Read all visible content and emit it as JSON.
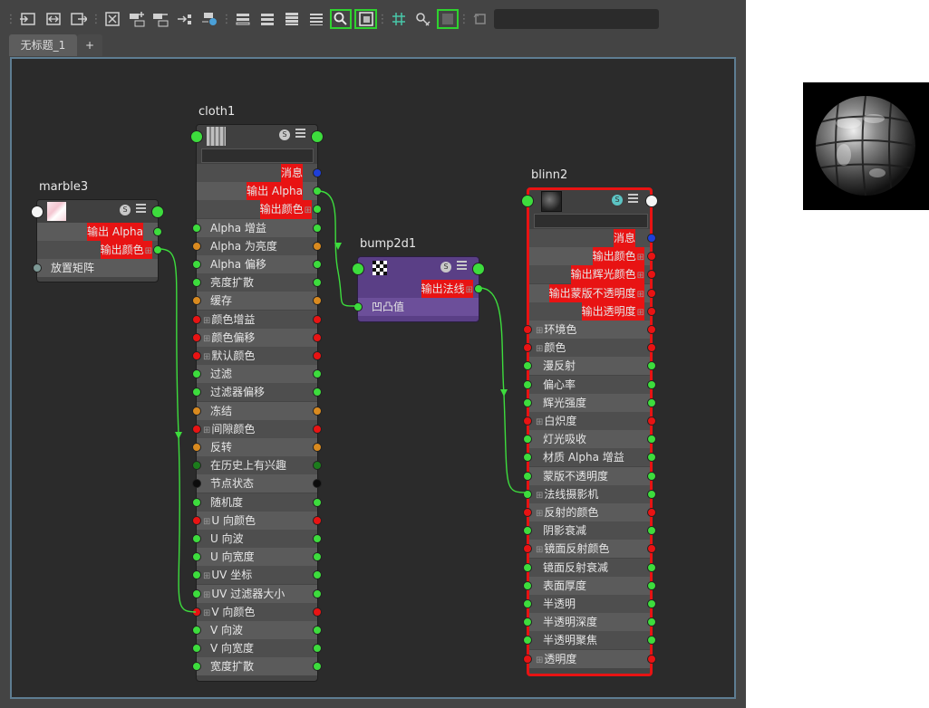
{
  "tabs": {
    "active_label": "无标题_1",
    "add_label": "+"
  },
  "toolbar": {
    "icons": [
      "input-connections-icon",
      "output-connections-icon",
      "in-out-connections-icon",
      "clear-graph-icon",
      "add-selected-icon",
      "remove-selected-icon",
      "rearrange-graph-icon",
      "graph-materials-icon",
      "simple-mode-icon",
      "connected-mode-icon",
      "full-mode-icon",
      "custom-mode-icon",
      "frame-selection-icon",
      "frame-all-icon",
      "grid-toggle-icon",
      "link-toggle-icon",
      "swatch-toggle-icon",
      "refresh-icon"
    ],
    "search_placeholder": ""
  },
  "nodes": {
    "marble3": {
      "title": "marble3",
      "rows": [
        "输出 Alpha",
        "输出颜色",
        "放置矩阵"
      ]
    },
    "cloth1": {
      "title": "cloth1",
      "rows": [
        "消息",
        "输出 Alpha",
        "输出颜色",
        "Alpha 增益",
        "Alpha 为亮度",
        "Alpha 偏移",
        "亮度扩散",
        "缓存",
        "颜色增益",
        "颜色偏移",
        "默认颜色",
        "过滤",
        "过滤器偏移",
        "冻结",
        "间隙颜色",
        "反转",
        "在历史上有兴趣",
        "节点状态",
        "随机度",
        "U 向颜色",
        "U 向波",
        "U 向宽度",
        "UV 坐标",
        "UV 过滤器大小",
        "V 向颜色",
        "V 向波",
        "V 向宽度",
        "宽度扩散"
      ]
    },
    "bump2d1": {
      "title": "bump2d1",
      "rows": [
        "输出法线",
        "凹凸值"
      ]
    },
    "blinn2": {
      "title": "blinn2",
      "rows": [
        "消息",
        "输出颜色",
        "输出辉光颜色",
        "输出蒙版不透明度",
        "输出透明度",
        "环境色",
        "颜色",
        "漫反射",
        "偏心率",
        "辉光强度",
        "白炽度",
        "灯光吸收",
        "材质 Alpha 增益",
        "蒙版不透明度",
        "法线摄影机",
        "反射的颜色",
        "阴影衰减",
        "镜面反射颜色",
        "镜面反射衰减",
        "表面厚度",
        "半透明",
        "半透明深度",
        "半透明聚焦",
        "透明度"
      ]
    }
  },
  "colors": {
    "port_green": "#3ddc3d",
    "port_orange": "#d98a1f",
    "port_red": "#e81313",
    "port_blue": "#1e3fd9",
    "selection_red": "#e81313",
    "bump_purple": "#5a3f86",
    "wire_green": "#3ddc3d",
    "canvas_border": "#5e7d92"
  }
}
